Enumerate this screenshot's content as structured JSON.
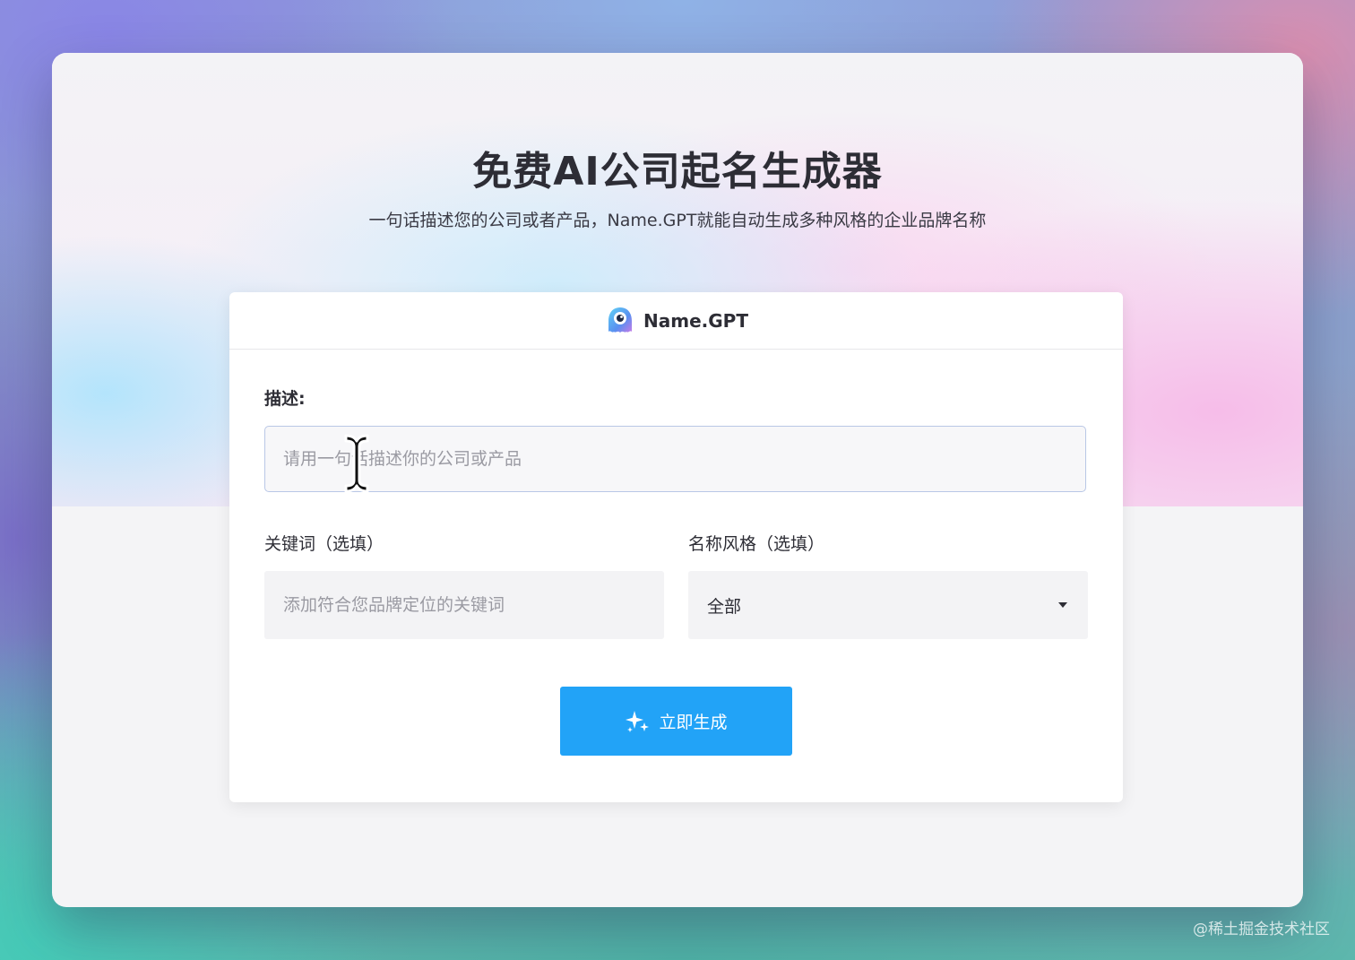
{
  "hero": {
    "title": "免费AI公司起名生成器",
    "subtitle": "一句话描述您的公司或者产品，Name.GPT就能自动生成多种风格的企业品牌名称"
  },
  "card": {
    "brand_name": "Name.GPT",
    "brand_icon": "name-gpt-mascot-logo",
    "description": {
      "label": "描述:",
      "placeholder": "请用一句话描述你的公司或产品",
      "value": ""
    },
    "keywords": {
      "label": "关键词（选填）",
      "placeholder": "添加符合您品牌定位的关键词",
      "value": ""
    },
    "name_style": {
      "label": "名称风格（选填）",
      "selected": "全部"
    },
    "generate_button": {
      "label": "立即生成",
      "icon": "sparkle-icon",
      "color": "#22a3f7"
    }
  },
  "watermark": "@稀土掘金技术社区"
}
